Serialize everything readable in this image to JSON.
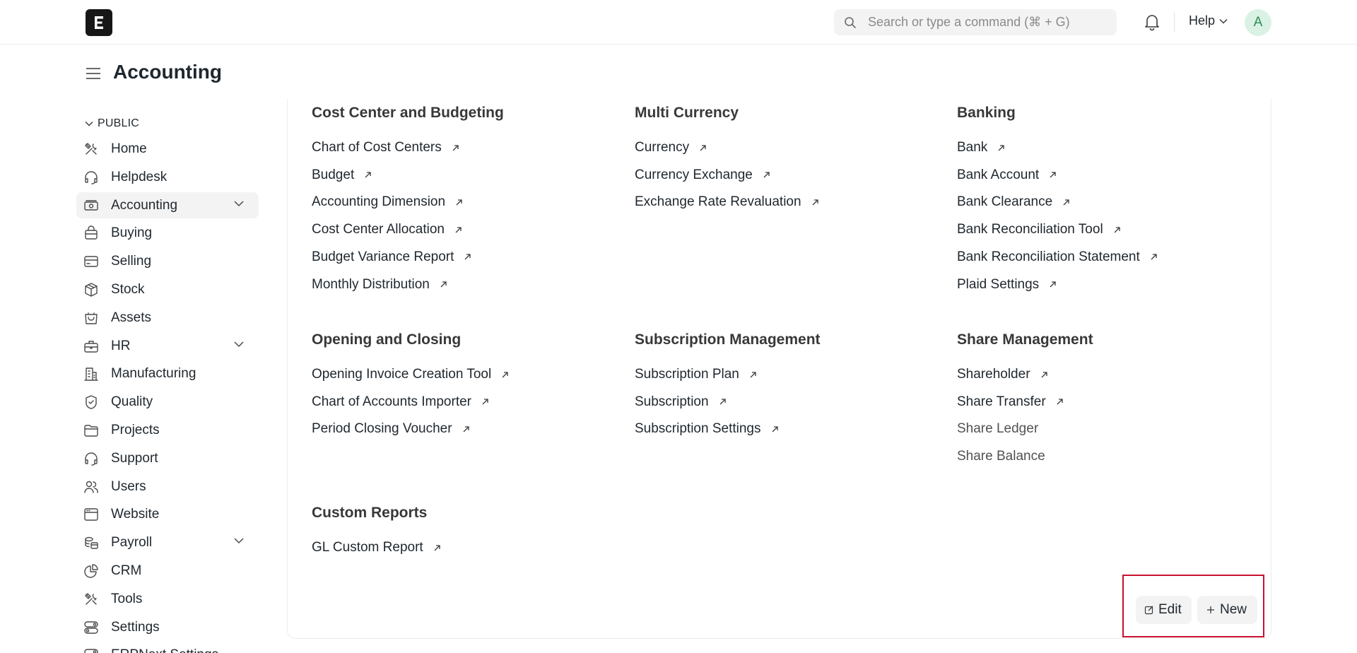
{
  "navbar": {
    "logo_letter": "E",
    "search_placeholder": "Search or type a command (⌘ + G)",
    "help_label": "Help",
    "avatar_initial": "A",
    "icons": [
      "search-icon",
      "bell-icon",
      "chevron-down-icon"
    ]
  },
  "page": {
    "title": "Accounting"
  },
  "sidebar": {
    "section_label": "PUBLIC",
    "items": [
      {
        "label": "Home",
        "icon": "tools-icon",
        "active": false,
        "expandable": false
      },
      {
        "label": "Helpdesk",
        "icon": "headset-icon",
        "active": false,
        "expandable": false
      },
      {
        "label": "Accounting",
        "icon": "money-icon",
        "active": true,
        "expandable": true
      },
      {
        "label": "Buying",
        "icon": "bag-icon",
        "active": false,
        "expandable": false
      },
      {
        "label": "Selling",
        "icon": "card-icon",
        "active": false,
        "expandable": false
      },
      {
        "label": "Stock",
        "icon": "box-icon",
        "active": false,
        "expandable": false
      },
      {
        "label": "Assets",
        "icon": "basket-icon",
        "active": false,
        "expandable": false
      },
      {
        "label": "HR",
        "icon": "briefcase-icon",
        "active": false,
        "expandable": true
      },
      {
        "label": "Manufacturing",
        "icon": "building-icon",
        "active": false,
        "expandable": false
      },
      {
        "label": "Quality",
        "icon": "badge-icon",
        "active": false,
        "expandable": false
      },
      {
        "label": "Projects",
        "icon": "folder-icon",
        "active": false,
        "expandable": false
      },
      {
        "label": "Support",
        "icon": "headset-icon",
        "active": false,
        "expandable": false
      },
      {
        "label": "Users",
        "icon": "users-icon",
        "active": false,
        "expandable": false
      },
      {
        "label": "Website",
        "icon": "browser-icon",
        "active": false,
        "expandable": false
      },
      {
        "label": "Payroll",
        "icon": "coins-icon",
        "active": false,
        "expandable": true
      },
      {
        "label": "CRM",
        "icon": "pie-icon",
        "active": false,
        "expandable": false
      },
      {
        "label": "Tools",
        "icon": "tools-icon",
        "active": false,
        "expandable": false
      },
      {
        "label": "Settings",
        "icon": "settings-icon",
        "active": false,
        "expandable": false
      },
      {
        "label": "ERPNext Settings",
        "icon": "settings-icon",
        "active": false,
        "expandable": false
      }
    ]
  },
  "sections": [
    {
      "title": "Cost Center and Budgeting",
      "links": [
        {
          "label": "Chart of Cost Centers",
          "arrow": true
        },
        {
          "label": "Budget",
          "arrow": true
        },
        {
          "label": "Accounting Dimension",
          "arrow": true
        },
        {
          "label": "Cost Center Allocation",
          "arrow": true
        },
        {
          "label": "Budget Variance Report",
          "arrow": true
        },
        {
          "label": "Monthly Distribution",
          "arrow": true
        }
      ]
    },
    {
      "title": "Multi Currency",
      "links": [
        {
          "label": "Currency",
          "arrow": true
        },
        {
          "label": "Currency Exchange",
          "arrow": true
        },
        {
          "label": "Exchange Rate Revaluation",
          "arrow": true
        }
      ]
    },
    {
      "title": "Banking",
      "links": [
        {
          "label": "Bank",
          "arrow": true
        },
        {
          "label": "Bank Account",
          "arrow": true
        },
        {
          "label": "Bank Clearance",
          "arrow": true
        },
        {
          "label": "Bank Reconciliation Tool",
          "arrow": true
        },
        {
          "label": "Bank Reconciliation Statement",
          "arrow": true
        },
        {
          "label": "Plaid Settings",
          "arrow": true
        }
      ]
    },
    {
      "title": "Opening and Closing",
      "links": [
        {
          "label": "Opening Invoice Creation Tool",
          "arrow": true
        },
        {
          "label": "Chart of Accounts Importer",
          "arrow": true
        },
        {
          "label": "Period Closing Voucher",
          "arrow": true
        }
      ]
    },
    {
      "title": "Subscription Management",
      "links": [
        {
          "label": "Subscription Plan",
          "arrow": true
        },
        {
          "label": "Subscription",
          "arrow": true
        },
        {
          "label": "Subscription Settings",
          "arrow": true
        }
      ]
    },
    {
      "title": "Share Management",
      "links": [
        {
          "label": "Shareholder",
          "arrow": true
        },
        {
          "label": "Share Transfer",
          "arrow": true
        },
        {
          "label": "Share Ledger",
          "arrow": false
        },
        {
          "label": "Share Balance",
          "arrow": false
        }
      ]
    },
    {
      "title": "Custom Reports",
      "links": [
        {
          "label": "GL Custom Report",
          "arrow": true
        }
      ]
    }
  ],
  "actions": {
    "edit_label": "Edit",
    "new_label": "New",
    "highlight_color": "#c8102e"
  }
}
